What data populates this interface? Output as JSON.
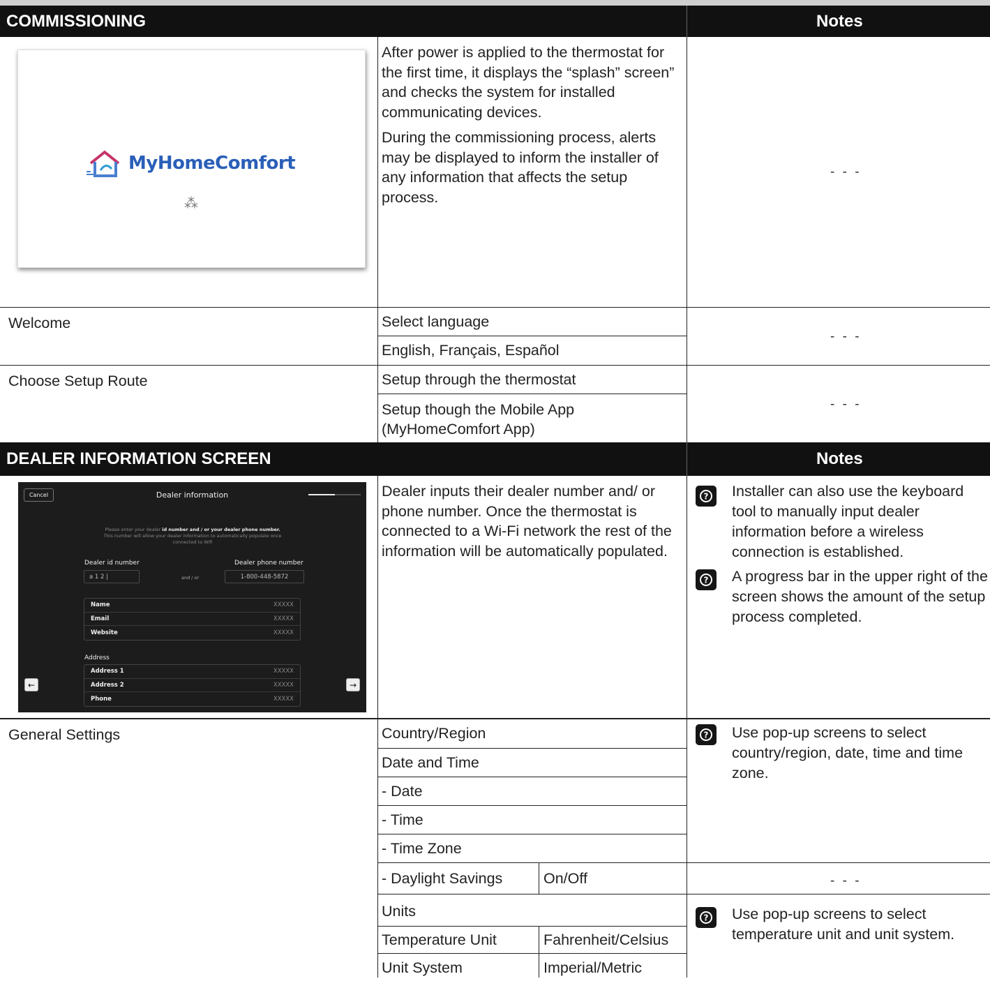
{
  "sections": [
    {
      "title": "COMMISSIONING",
      "notes_label": "Notes"
    },
    {
      "title": "DEALER INFORMATION SCREEN",
      "notes_label": "Notes"
    }
  ],
  "commissioning": {
    "splash_brand": "MyHomeComfort",
    "paragraphs": [
      "After power is applied to the thermostat for the first time, it displays the “splash” screen” and checks the system for installed communicating devices.",
      "During the commissioning process, alerts may be displayed to inform the installer of any information that affects the setup process."
    ],
    "note": "- - -"
  },
  "welcome": {
    "label": "Welcome",
    "options": [
      "Select language",
      "English, Français, Español"
    ],
    "note": "- - -"
  },
  "setup_route": {
    "label": "Choose Setup Route",
    "options": [
      "Setup through the thermostat",
      "Setup though the Mobile App (MyHomeComfort App)"
    ],
    "note": "- - -"
  },
  "dealer": {
    "description": "Dealer inputs their dealer number and/ or phone number. Once the thermostat is connected to a Wi-Fi network the rest of the information will be automatically populated.",
    "notes": [
      "Installer can also use the keyboard tool to manually input dealer information before a wireless connection is established.",
      "A progress bar in the upper right of the screen shows the amount of the setup process completed."
    ],
    "progress": 0.5,
    "screen": {
      "cancel": "Cancel",
      "title": "Dealer information",
      "prompt_pre": "Please enter your dealer ",
      "prompt_bold": "id number and / or your dealer phone number.",
      "prompt_l2": "This number will allow your dealer information to automatically populate once",
      "prompt_l3": "connected to Wifi",
      "id_label": "Dealer id number",
      "phone_label": "Dealer phone number",
      "id_value": "a 1 2 |",
      "andor": "and / or",
      "phone_value": "1-800-448-5872",
      "info_rows": [
        {
          "k": "Name",
          "v": "XXXXX"
        },
        {
          "k": "Email",
          "v": "XXXXX"
        },
        {
          "k": "Website",
          "v": "XXXXX"
        }
      ],
      "address_label": "Address",
      "address_rows": [
        {
          "k": "Address 1",
          "v": "XXXXX"
        },
        {
          "k": "Address 2",
          "v": "XXXXX"
        },
        {
          "k": "Phone",
          "v": "XXXXX"
        }
      ]
    }
  },
  "general": {
    "label": "General Settings",
    "items": [
      "Country/Region",
      "Date and Time",
      "- Date",
      "- Time",
      "- Time Zone"
    ],
    "daylight": {
      "k": "- Daylight Savings",
      "v": "On/Off"
    },
    "units": "Units",
    "temp_unit": {
      "k": "Temperature Unit",
      "v": "Fahrenheit/Celsius"
    },
    "unit_system": {
      "k": "Unit System",
      "v": "Imperial/Metric"
    },
    "note1": "Use pop-up screens to select country/region, date, time and time zone.",
    "note_dash": "- - -",
    "note2": "Use pop-up screens to select temperature unit and unit system."
  }
}
